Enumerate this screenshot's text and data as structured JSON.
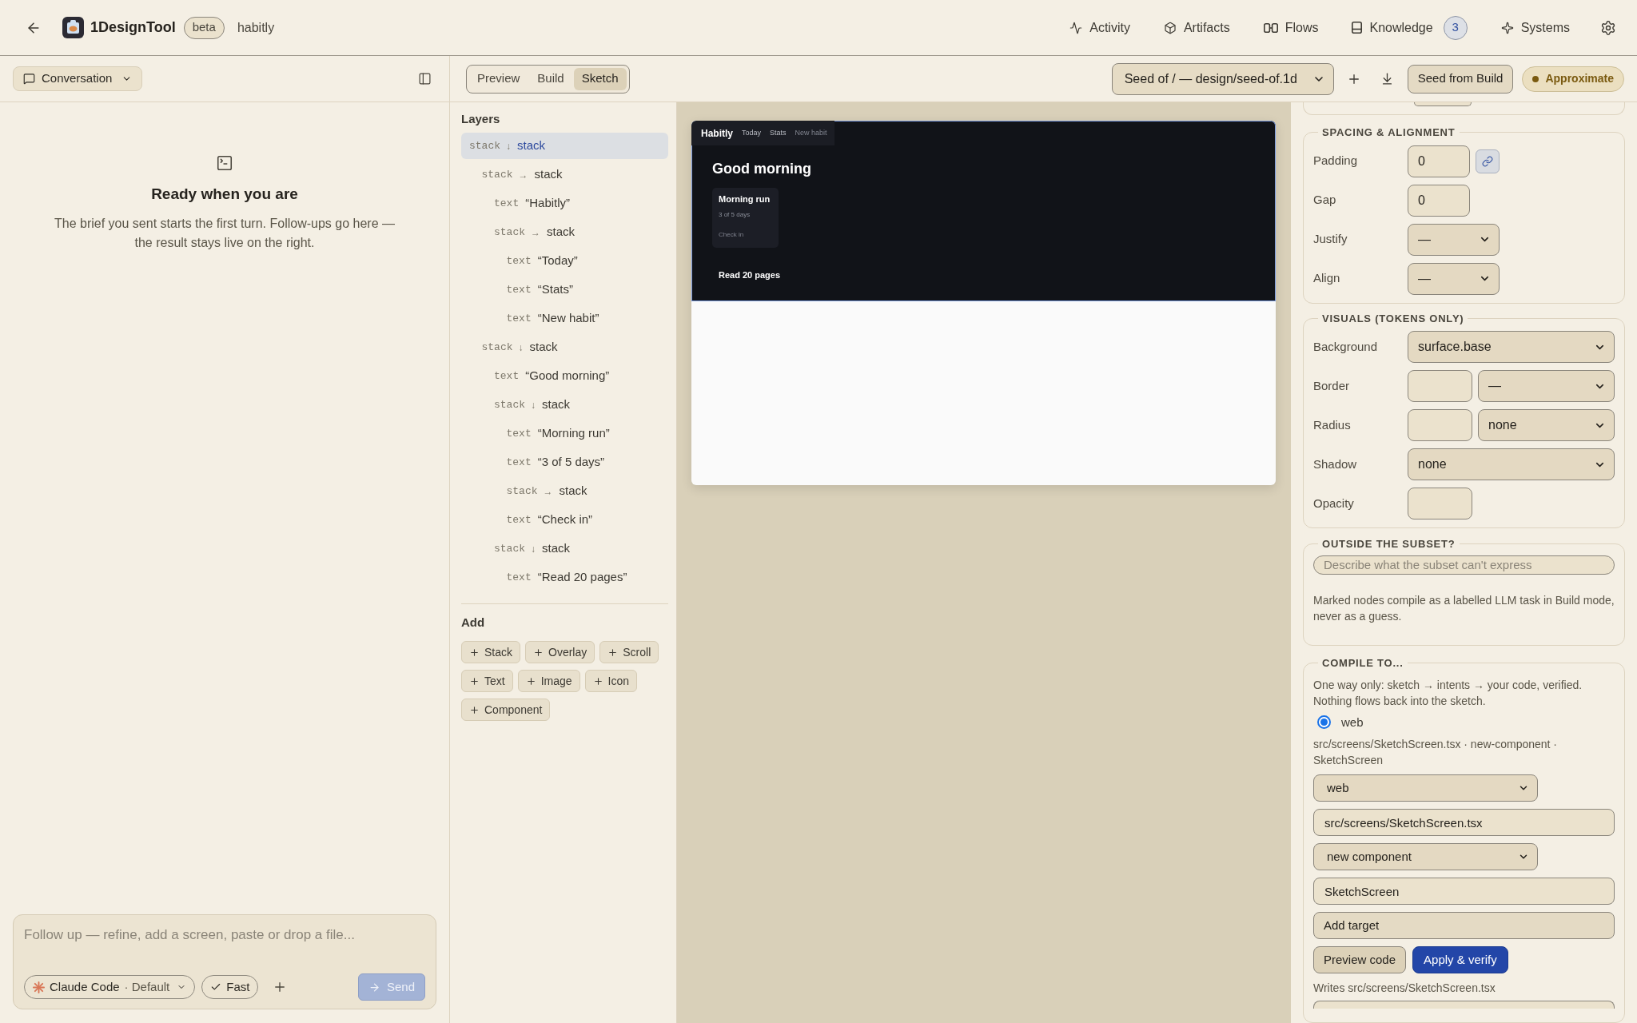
{
  "app_bar": {
    "product": "1DesignTool",
    "badge": "beta",
    "project": "habitly",
    "nav": [
      {
        "kind": "activity",
        "label": "Activity"
      },
      {
        "kind": "artifacts",
        "label": "Artifacts"
      },
      {
        "kind": "flows",
        "label": "Flows"
      },
      {
        "kind": "knowledge",
        "label": "Knowledge",
        "count": "3"
      },
      {
        "kind": "systems",
        "label": "Systems"
      }
    ]
  },
  "conversation": {
    "menu_label": "Conversation",
    "empty_title": "Ready when you are",
    "empty_text": "The brief you sent starts the first turn. Follow-ups go here — the result stays live on the right.",
    "composer": {
      "placeholder": "Follow up — refine, add a screen, paste or drop a file...",
      "agent": "Claude Code",
      "agent_mode": "· Default",
      "speed": "Fast",
      "send": {
        "label": "Send",
        "disabled": true
      }
    }
  },
  "view_tabs": [
    {
      "label": "Preview",
      "selected": false
    },
    {
      "label": "Build",
      "selected": false
    },
    {
      "label": "Sketch",
      "selected": true
    }
  ],
  "toolbar": {
    "seed_select": "Seed of / — design/seed-of.1d",
    "seed_button": "Seed from Build",
    "status": "Approximate"
  },
  "layers": {
    "title": "Layers",
    "tree": [
      {
        "type": "stack",
        "direction": "↓",
        "label": "stack",
        "selected": true,
        "children": [
          {
            "type": "stack",
            "direction": "→",
            "label": "stack",
            "selected": false,
            "children": [
              {
                "type": "text",
                "label": "“Habitly”",
                "selected": false
              },
              {
                "type": "stack",
                "direction": "→",
                "label": "stack",
                "selected": false,
                "children": [
                  {
                    "type": "text",
                    "label": "“Today”",
                    "selected": false
                  },
                  {
                    "type": "text",
                    "label": "“Stats”",
                    "selected": false
                  },
                  {
                    "type": "text",
                    "label": "“New habit”",
                    "selected": false
                  }
                ]
              }
            ]
          },
          {
            "type": "stack",
            "direction": "↓",
            "label": "stack",
            "selected": false,
            "children": [
              {
                "type": "text",
                "label": "“Good morning”",
                "selected": false
              },
              {
                "type": "stack",
                "direction": "↓",
                "label": "stack",
                "selected": false,
                "children": [
                  {
                    "type": "text",
                    "label": "“Morning run”",
                    "selected": false
                  },
                  {
                    "type": "text",
                    "label": "“3 of 5 days”",
                    "selected": false
                  },
                  {
                    "type": "stack",
                    "direction": "→",
                    "label": "stack",
                    "selected": false
                  },
                  {
                    "type": "text",
                    "label": "“Check in”",
                    "selected": false
                  }
                ]
              },
              {
                "type": "stack",
                "direction": "↓",
                "label": "stack",
                "selected": false,
                "children": [
                  {
                    "type": "text",
                    "label": "“Read 20 pages”",
                    "selected": false
                  }
                ]
              }
            ]
          }
        ]
      }
    ]
  },
  "add": {
    "title": "Add",
    "buttons": [
      "Stack",
      "Overlay",
      "Scroll",
      "Text",
      "Image",
      "Icon",
      "Component"
    ]
  },
  "sketch_preview": {
    "brand": "Habitly",
    "links": [
      "Today",
      "Stats",
      "New habit"
    ],
    "heading": "Good morning",
    "card": {
      "title": "Morning run",
      "detail": "3 of 5 days",
      "action": "Check in"
    },
    "item": "Read 20 pages"
  },
  "inspector": {
    "sections": [
      {
        "title": "SPACING & ALIGNMENT",
        "rows": [
          {
            "label": "Padding",
            "controls": [
              {
                "kind": "number",
                "value": "0"
              },
              {
                "kind": "link",
                "on": true
              }
            ]
          },
          {
            "label": "Gap",
            "controls": [
              {
                "kind": "number",
                "value": "0"
              }
            ]
          },
          {
            "label": "Justify",
            "controls": [
              {
                "kind": "select",
                "value": "—"
              }
            ]
          },
          {
            "label": "Align",
            "controls": [
              {
                "kind": "select",
                "value": "—"
              }
            ]
          }
        ]
      },
      {
        "title": "VISUALS (TOKENS ONLY)",
        "rows": [
          {
            "label": "Background",
            "controls": [
              {
                "kind": "select",
                "value": "surface.base"
              }
            ]
          },
          {
            "label": "Border",
            "controls": [
              {
                "kind": "number"
              },
              {
                "kind": "select",
                "value": "—"
              }
            ]
          },
          {
            "label": "Radius",
            "controls": [
              {
                "kind": "number"
              },
              {
                "kind": "select",
                "value": "none"
              }
            ]
          },
          {
            "label": "Shadow",
            "controls": [
              {
                "kind": "select",
                "value": "none"
              }
            ]
          },
          {
            "label": "Opacity",
            "controls": [
              {
                "kind": "number"
              }
            ]
          }
        ]
      }
    ],
    "subset": {
      "title": "OUTSIDE THE SUBSET?",
      "placeholder": "Describe what the subset can't express",
      "note": "Marked nodes compile as a labelled LLM task in Build mode, never as a guess."
    },
    "compile": {
      "title": "COMPILE TO...",
      "intro": "One way only: sketch → intents → your code, verified. Nothing flows back into the sketch.",
      "targets": [
        {
          "label": "web",
          "checked": true
        }
      ],
      "summary": "src/screens/SketchScreen.tsx · new-component · SketchScreen",
      "platform": "web",
      "path": "src/screens/SketchScreen.tsx",
      "mode": "new component",
      "component": "SketchScreen",
      "add_button": "Add target",
      "preview_button": "Preview code",
      "apply_button": "Apply & verify",
      "writes": "Writes src/screens/SketchScreen.tsx"
    }
  }
}
